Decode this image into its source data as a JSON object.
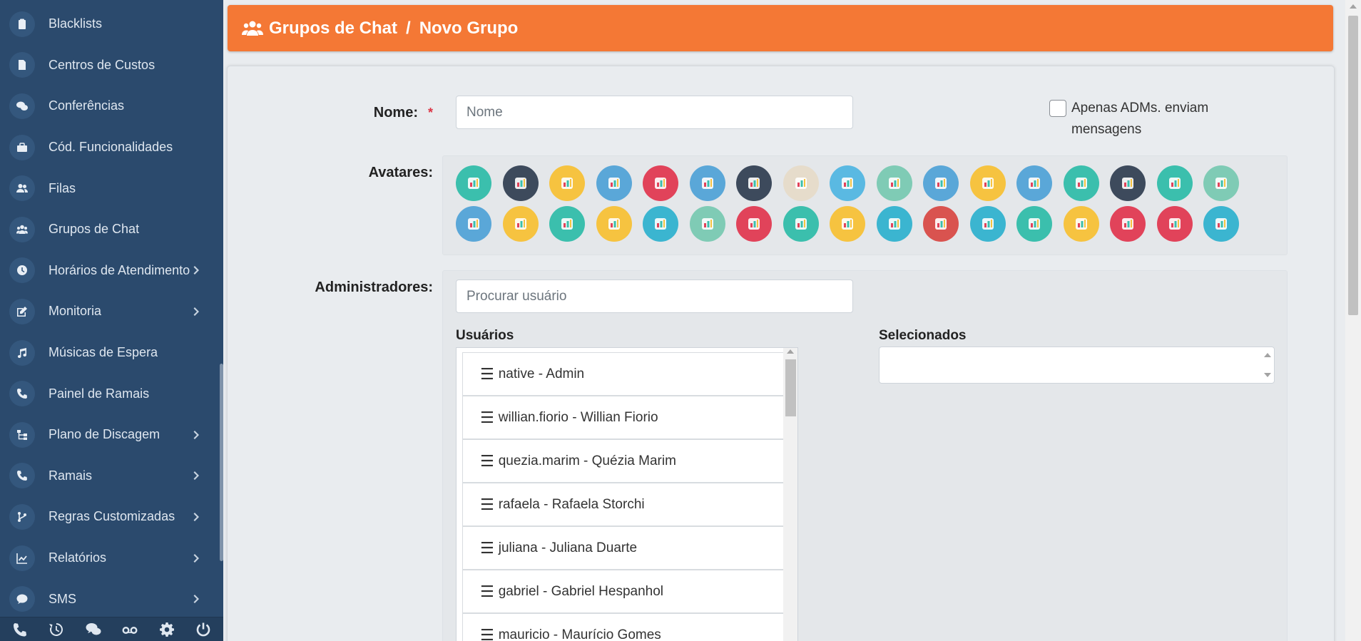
{
  "sidebar": {
    "items": [
      {
        "label": "Blacklists",
        "icon": "clipboard-icon",
        "arrow": false
      },
      {
        "label": "Centros de Custos",
        "icon": "file-icon",
        "arrow": false
      },
      {
        "label": "Conferências",
        "icon": "comments-icon",
        "arrow": false
      },
      {
        "label": "Cód. Funcionalidades",
        "icon": "briefcase-icon",
        "arrow": false
      },
      {
        "label": "Filas",
        "icon": "users-icon",
        "arrow": false
      },
      {
        "label": "Grupos de Chat",
        "icon": "users-group-icon",
        "arrow": false
      },
      {
        "label": "Horários de Atendimento",
        "icon": "clock-icon",
        "arrow": true
      },
      {
        "label": "Monitoria",
        "icon": "edit-icon",
        "arrow": true
      },
      {
        "label": "Músicas de Espera",
        "icon": "music-icon",
        "arrow": false
      },
      {
        "label": "Painel de Ramais",
        "icon": "phone-icon",
        "arrow": false
      },
      {
        "label": "Plano de Discagem",
        "icon": "sitemap-icon",
        "arrow": true
      },
      {
        "label": "Ramais",
        "icon": "phone-icon",
        "arrow": true
      },
      {
        "label": "Regras Customizadas",
        "icon": "code-branch-icon",
        "arrow": true
      },
      {
        "label": "Relatórios",
        "icon": "chart-line-icon",
        "arrow": true
      },
      {
        "label": "SMS",
        "icon": "sms-icon",
        "arrow": true
      }
    ],
    "bottom_icons": [
      "phone-icon",
      "history-icon",
      "comments-icon",
      "voicemail-icon",
      "gear-icon",
      "power-icon"
    ]
  },
  "header": {
    "icon": "users-group-icon",
    "section": "Grupos de Chat",
    "separator": "/",
    "page": "Novo Grupo"
  },
  "form": {
    "name_label": "Nome:",
    "required_mark": "*",
    "name_placeholder": "Nome",
    "name_value": "",
    "admins_only_label": "Apenas ADMs. enviam mensagens",
    "admins_only_checked": false,
    "avatars_label": "Avatares:",
    "administrators_label": "Administradores:",
    "search_placeholder": "Procurar usuário",
    "users_title": "Usuários",
    "selected_title": "Selecionados",
    "users": [
      "native - Admin",
      "willian.fiorio - Willian Fiorio",
      "quezia.marim - Quézia Marim",
      "rafaela - Rafaela Storchi",
      "juliana - Juliana Duarte",
      "gabriel - Gabriel Hespanhol",
      "mauricio - Maurício Gomes"
    ],
    "selected_users": []
  },
  "avatars": [
    {
      "name": "chart-search-avatar",
      "bg": "#3bbfad"
    },
    {
      "name": "bar-chart-avatar",
      "bg": "#3d4a5c"
    },
    {
      "name": "businessman-avatar",
      "bg": "#f6c340"
    },
    {
      "name": "books-avatar",
      "bg": "#5aa7d8"
    },
    {
      "name": "hand-truck-avatar",
      "bg": "#e1435a"
    },
    {
      "name": "newspaper-avatar",
      "bg": "#5aa7d8"
    },
    {
      "name": "calculator-avatar",
      "bg": "#3d4a5c"
    },
    {
      "name": "basket-avatar",
      "bg": "#e6dccb"
    },
    {
      "name": "chat-bubble-avatar",
      "bg": "#5ab9e2"
    },
    {
      "name": "checkbox-avatar",
      "bg": "#7fcbb5"
    },
    {
      "name": "clipboard-avatar",
      "bg": "#5aa7d8"
    },
    {
      "name": "team-avatar",
      "bg": "#f6c340"
    },
    {
      "name": "signpost-avatar",
      "bg": "#5aa7d8"
    },
    {
      "name": "time-person-avatar",
      "bg": "#3bbfad"
    },
    {
      "name": "presentation-avatar",
      "bg": "#3d4a5c"
    },
    {
      "name": "cash-person-avatar",
      "bg": "#3bbfad"
    },
    {
      "name": "settings-avatar",
      "bg": "#7fcbb5"
    },
    {
      "name": "globe-avatar",
      "bg": "#5aa7d8"
    },
    {
      "name": "document-chart-avatar",
      "bg": "#f6c340"
    },
    {
      "name": "growth-chart-avatar",
      "bg": "#3bbfad"
    },
    {
      "name": "headset-avatar",
      "bg": "#f6c340"
    },
    {
      "name": "map-avatar",
      "bg": "#3bb5d0"
    },
    {
      "name": "megaphone-avatar",
      "bg": "#7fcbb5"
    },
    {
      "name": "rising-graph-avatar",
      "bg": "#e1435a"
    },
    {
      "name": "money-envelope-avatar",
      "bg": "#3bbfad"
    },
    {
      "name": "phone-avatar",
      "bg": "#f6c340"
    },
    {
      "name": "phone-handset-avatar",
      "bg": "#3bb5d0"
    },
    {
      "name": "power-avatar",
      "bg": "#d9534f"
    },
    {
      "name": "tools-avatar",
      "bg": "#3bb5d0"
    },
    {
      "name": "support-person-avatar",
      "bg": "#3bbfad"
    },
    {
      "name": "target-avatar",
      "bg": "#f6c340"
    },
    {
      "name": "group-avatar",
      "bg": "#e1435a"
    },
    {
      "name": "delivery-truck-avatar",
      "bg": "#e1435a"
    },
    {
      "name": "wrench-avatar",
      "bg": "#3bb5d0"
    }
  ]
}
